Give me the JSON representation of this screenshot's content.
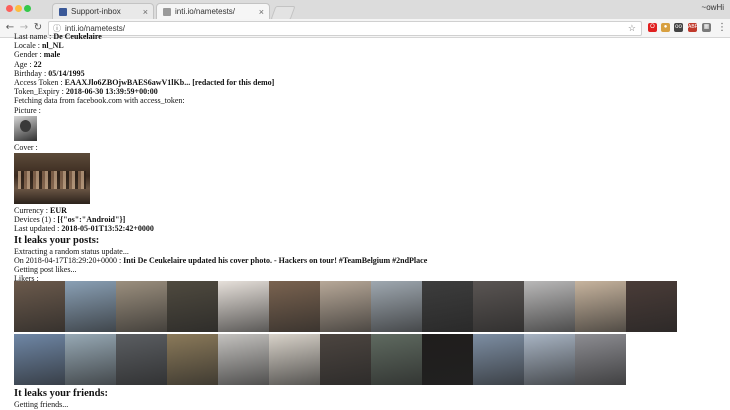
{
  "browser": {
    "tabs": [
      {
        "label": "Support-inbox",
        "favicon": "facebook-icon",
        "favicon_color": "#3b5998"
      },
      {
        "label": "inti.io/nametests/",
        "favicon": "page-icon",
        "favicon_color": "#9a9a9a"
      }
    ],
    "profile_label": "~owHi",
    "url": "inti.io/nametests/",
    "extensions": [
      {
        "name": "opera-icon",
        "color": "#e02020",
        "text": "O"
      },
      {
        "name": "cookie-icon",
        "color": "#d8a040",
        "text": "●"
      },
      {
        "name": "glasses-icon",
        "color": "#444444",
        "text": "oo"
      },
      {
        "name": "abp-icon",
        "color": "#c0392b",
        "text": "ABP"
      },
      {
        "name": "extension-icon",
        "color": "#7a7a7a",
        "text": "▦"
      }
    ]
  },
  "profile": {
    "last_name": {
      "label": "Last name : ",
      "value": "De Ceukelaire"
    },
    "locale": {
      "label": "Locale : ",
      "value": "nl_NL"
    },
    "gender": {
      "label": "Gender : ",
      "value": "male"
    },
    "age": {
      "label": "Age : ",
      "value": "22"
    },
    "birthday": {
      "label": "Birthday : ",
      "value": "05/14/1995"
    },
    "access_token": {
      "label": "Access Token : ",
      "value": "EAAXJlo6ZBOjwBAES6awV1lKb... [redacted for this demo]"
    },
    "token_expiry": {
      "label": "Token_Expiry : ",
      "value": "2018-06-30 13:39:59+00:00"
    },
    "fetching": "Fetching data from facebook.com with access_token:",
    "picture_label": "Picture :",
    "cover_label": "Cover :",
    "currency": {
      "label": "Currency : ",
      "value": "EUR"
    },
    "devices": {
      "label": "Devices (1) : ",
      "value": "[{\"os\":\"Android\"}]"
    },
    "last_updated": {
      "label": "Last updated : ",
      "value": "2018-05-01T13:52:42+0000"
    }
  },
  "posts": {
    "heading": "It leaks your posts:",
    "extracting": "Extracting a random status update...",
    "post_prefix": "On 2018-04-17T18:29:20+0000 : ",
    "post_text": "Inti De Ceukelaire updated his cover photo. - Hackers on tour! #TeamBelgium #2ndPlace",
    "getting_likes": "Getting post likes...",
    "likers_label": "Likers :"
  },
  "likers": {
    "row1": [
      "#6b5a4c",
      "#8aa0b5",
      "#9b8f7e",
      "#4f4a3f",
      "#e6e0da",
      "#7a6350",
      "#b7a898",
      "#9fa8b0",
      "#3d3d3d",
      "#5a5553",
      "#b9b8b8",
      "#c7b49e",
      "#4a3c38"
    ],
    "row2": [
      "#6f87a6",
      "#97a9b5",
      "#5b5e62",
      "#8b7a5a",
      "#c4c2bf",
      "#d8d2c9",
      "#4c4540",
      "#5f6a60",
      "#1f1d1c",
      "#7d8ea3",
      "#a8b4c3",
      "#8d8d92"
    ]
  },
  "friends": {
    "heading": "It leaks your friends:",
    "getting": "Getting friends..."
  }
}
